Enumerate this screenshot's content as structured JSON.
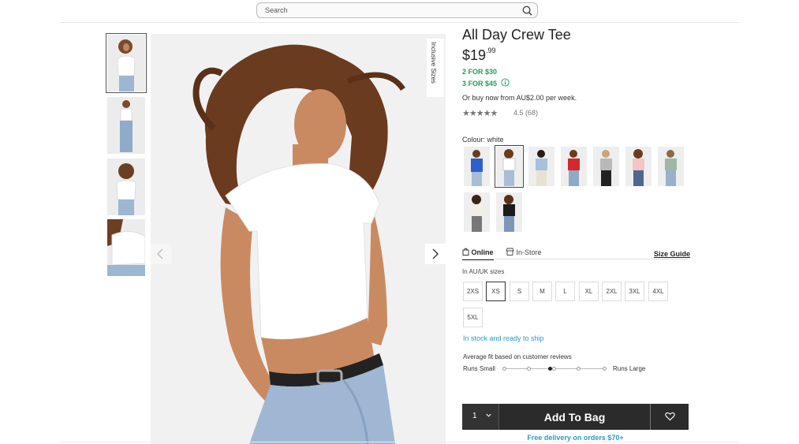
{
  "search": {
    "placeholder": "Search"
  },
  "gallery": {
    "inclusive_label": "Inclusive Sizes",
    "thumbnails": [
      "thumb-front",
      "thumb-full-length",
      "thumb-back",
      "thumb-detail"
    ]
  },
  "product": {
    "title": "All Day Crew Tee",
    "price_main": "$19",
    "price_cents": ".99",
    "promo_1": "2 FOR $30",
    "promo_2": "3 FOR $45",
    "afterpay": "Or buy now from AU$2.00 per week.",
    "stars": "★★★★★",
    "rating_text": "4.5 (68)",
    "rating_value": 4.5
  },
  "colour": {
    "label": "Colour: white",
    "swatches": [
      "blue",
      "white",
      "light blue",
      "red",
      "grey marle",
      "pink",
      "sage",
      "cream",
      "black"
    ]
  },
  "tabs": {
    "online": "Online",
    "in_store": "In-Store",
    "size_guide": "Size Guide"
  },
  "sizes": {
    "label": "In AU/UK sizes",
    "options": [
      "2XS",
      "XS",
      "S",
      "M",
      "L",
      "XL",
      "2XL",
      "3XL",
      "4XL",
      "5XL"
    ],
    "selected": "XS"
  },
  "stock": "In stock and ready to ship",
  "fit": {
    "title": "Average fit based on customer reviews",
    "small": "Runs Small",
    "large": "Runs Large",
    "selected_index": 3
  },
  "bag": {
    "qty": "1",
    "add_label": "Add To Bag"
  },
  "delivery": "Free delivery on orders $70+",
  "colors": {
    "promo_green": "#1f9e5b",
    "link_blue": "#2c9bc6",
    "bag_dark": "#2b2b2b"
  }
}
